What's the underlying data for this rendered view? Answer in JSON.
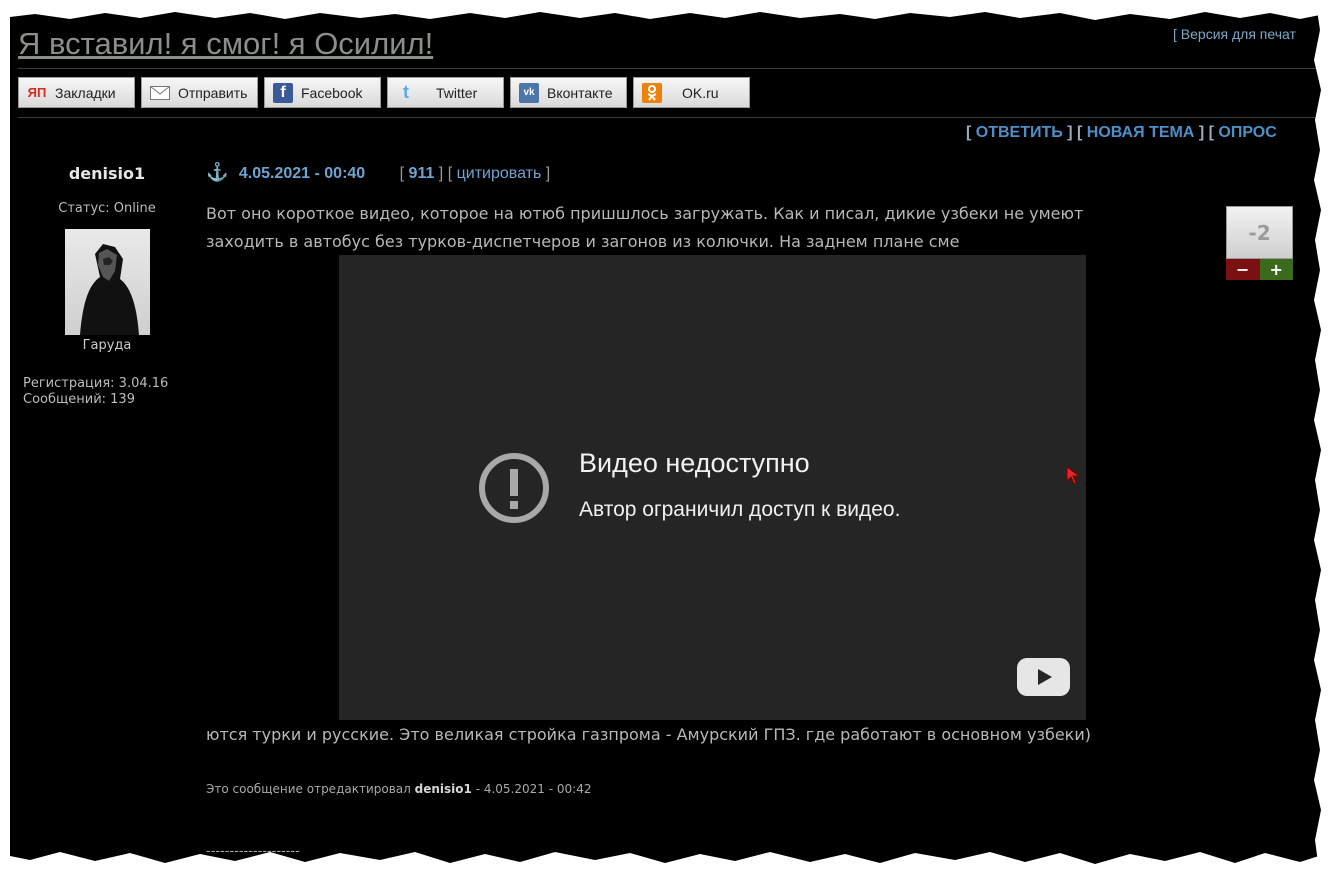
{
  "topic": {
    "title": "Я вставил! я смог! я Осилил!",
    "print_link": "[ Версия для печат"
  },
  "share": [
    {
      "label": "Закладки",
      "icon": "yandex-icon",
      "color": "#d52b1e"
    },
    {
      "label": "Отправить",
      "icon": "mail-icon",
      "color": "#888888"
    },
    {
      "label": "Facebook",
      "icon": "facebook-icon",
      "color": "#3b5998"
    },
    {
      "label": "Twitter",
      "icon": "twitter-icon",
      "color": "#55acee"
    },
    {
      "label": "Вконтакте",
      "icon": "vk-icon",
      "color": "#4a76a8"
    },
    {
      "label": "OK.ru",
      "icon": "ok-icon",
      "color": "#ee8208"
    }
  ],
  "actions": {
    "reply": "ОТВЕТИТЬ",
    "new_topic": "НОВАЯ ТЕМА",
    "poll": "ОПРОС"
  },
  "author": {
    "name": "denisio1",
    "status": "Статус: Online",
    "avatar_caption": "Гаруда",
    "registration": "Регистрация: 3.04.16",
    "messages": "Сообщений: 139"
  },
  "post": {
    "date": "4.05.2021 - 00:40",
    "number": "911",
    "quote": "цитировать",
    "text_line1": "Вот оно короткое видео, которое на ютюб пришшлось загружать. Как и писал, дикие узбеки не умеют",
    "text_line2": "заходить в автобус без турков-диспетчеров и загонов из колючки. На заднем плане сме",
    "text_line3": "ются турки и русские. Это великая стройка газпрома - Амурский ГПЗ. где работают в основном узбеки)",
    "rating": "-2",
    "rating_minus": "−",
    "rating_plus": "+",
    "edit_prefix": "Это сообщение отредактировал",
    "edit_user": "denisio1",
    "edit_suffix": "- 4.05.2021 - 00:42",
    "signature_line": "--------------------"
  },
  "video": {
    "title": "Видео недоступно",
    "subtitle": "Автор ограничил доступ к видео."
  }
}
